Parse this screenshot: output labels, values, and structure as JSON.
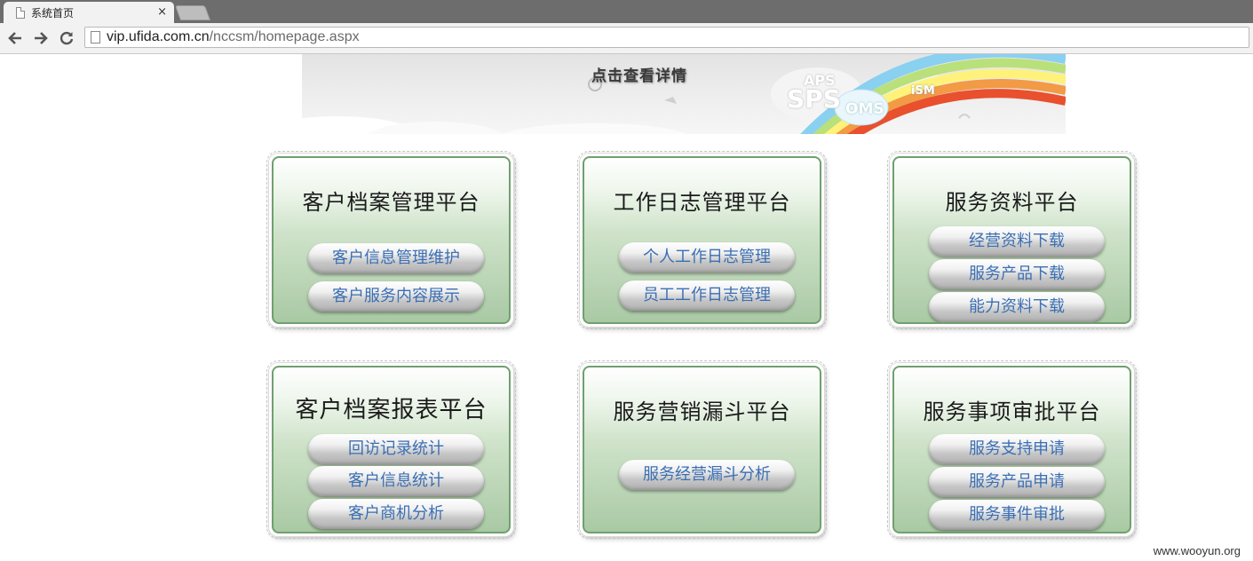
{
  "browser": {
    "tab_title": "系统首页",
    "url_host": "vip.ufida.com.cn",
    "url_path": "/nccsm/homepage.aspx"
  },
  "banner": {
    "text": "点击查看详情",
    "clouds": [
      "APS",
      "SPS",
      "OMS",
      "iSM"
    ]
  },
  "cards": [
    {
      "title": "客户档案管理平台",
      "buttons": [
        "客户信息管理维护",
        "客户服务内容展示"
      ]
    },
    {
      "title": "工作日志管理平台",
      "buttons": [
        "个人工作日志管理",
        "员工工作日志管理"
      ]
    },
    {
      "title": "服务资料平台",
      "buttons": [
        "经营资料下载",
        "服务产品下载",
        "能力资料下载"
      ]
    },
    {
      "title": "客户档案报表平台",
      "buttons": [
        "回访记录统计",
        "客户信息统计",
        "客户商机分析"
      ]
    },
    {
      "title": "服务营销漏斗平台",
      "buttons": [
        "服务经营漏斗分析"
      ]
    },
    {
      "title": "服务事项审批平台",
      "buttons": [
        "服务支持申请",
        "服务产品申请",
        "服务事件审批"
      ]
    }
  ],
  "watermark": "www.wooyun.org",
  "colors": {
    "card_border": "#6fa06f",
    "button_text": "#3b6fb4"
  }
}
